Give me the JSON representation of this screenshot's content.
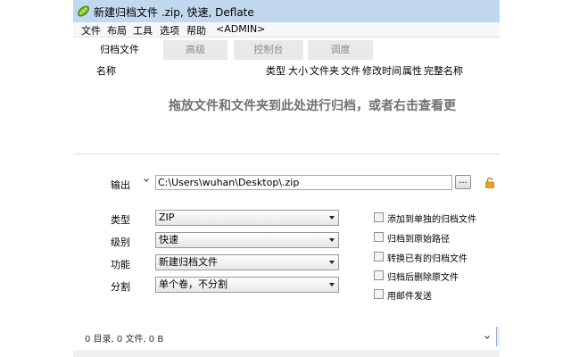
{
  "window": {
    "title": "新建归档文件 .zip, 快速, Deflate",
    "icon": "pea-pod-app-icon"
  },
  "menu": [
    "文件",
    "布局",
    "工具",
    "选项",
    "帮助",
    "<ADMIN>"
  ],
  "tabs": [
    {
      "label": "归档文件",
      "active": true
    },
    {
      "label": "高级",
      "active": false
    },
    {
      "label": "控制台",
      "active": false
    },
    {
      "label": "调度",
      "active": false
    }
  ],
  "columns": {
    "name": "名称",
    "right": [
      "类型",
      "大小",
      "文件夹",
      "文件",
      "修改时间",
      "属性",
      "完整名称"
    ]
  },
  "drop_hint": "拖放文件和文件夹到此处进行归档，或者右击查看更",
  "output": {
    "label": "输出",
    "path": "C:\\Users\\wuhan\\Desktop\\.zip",
    "browse_label": "...",
    "lock_icon": "open-lock-icon"
  },
  "options": [
    {
      "label": "类型",
      "value": "ZIP"
    },
    {
      "label": "级别",
      "value": "快速"
    },
    {
      "label": "功能",
      "value": "新建归档文件"
    },
    {
      "label": "分割",
      "value": "单个卷，不分割"
    }
  ],
  "checkboxes": [
    {
      "label": "添加到单独的归档文件",
      "checked": false
    },
    {
      "label": "归档到原始路径",
      "checked": false
    },
    {
      "label": "转换已有的归档文件",
      "checked": false
    },
    {
      "label": "归档后删除原文件",
      "checked": false
    },
    {
      "label": "用邮件发送",
      "checked": false
    }
  ],
  "status": {
    "text": "0 目录, 0 文件, 0 B"
  },
  "colors": {
    "titlebar": "#c2d8ef",
    "hint_text": "#707070",
    "lock": "#e8a317"
  }
}
